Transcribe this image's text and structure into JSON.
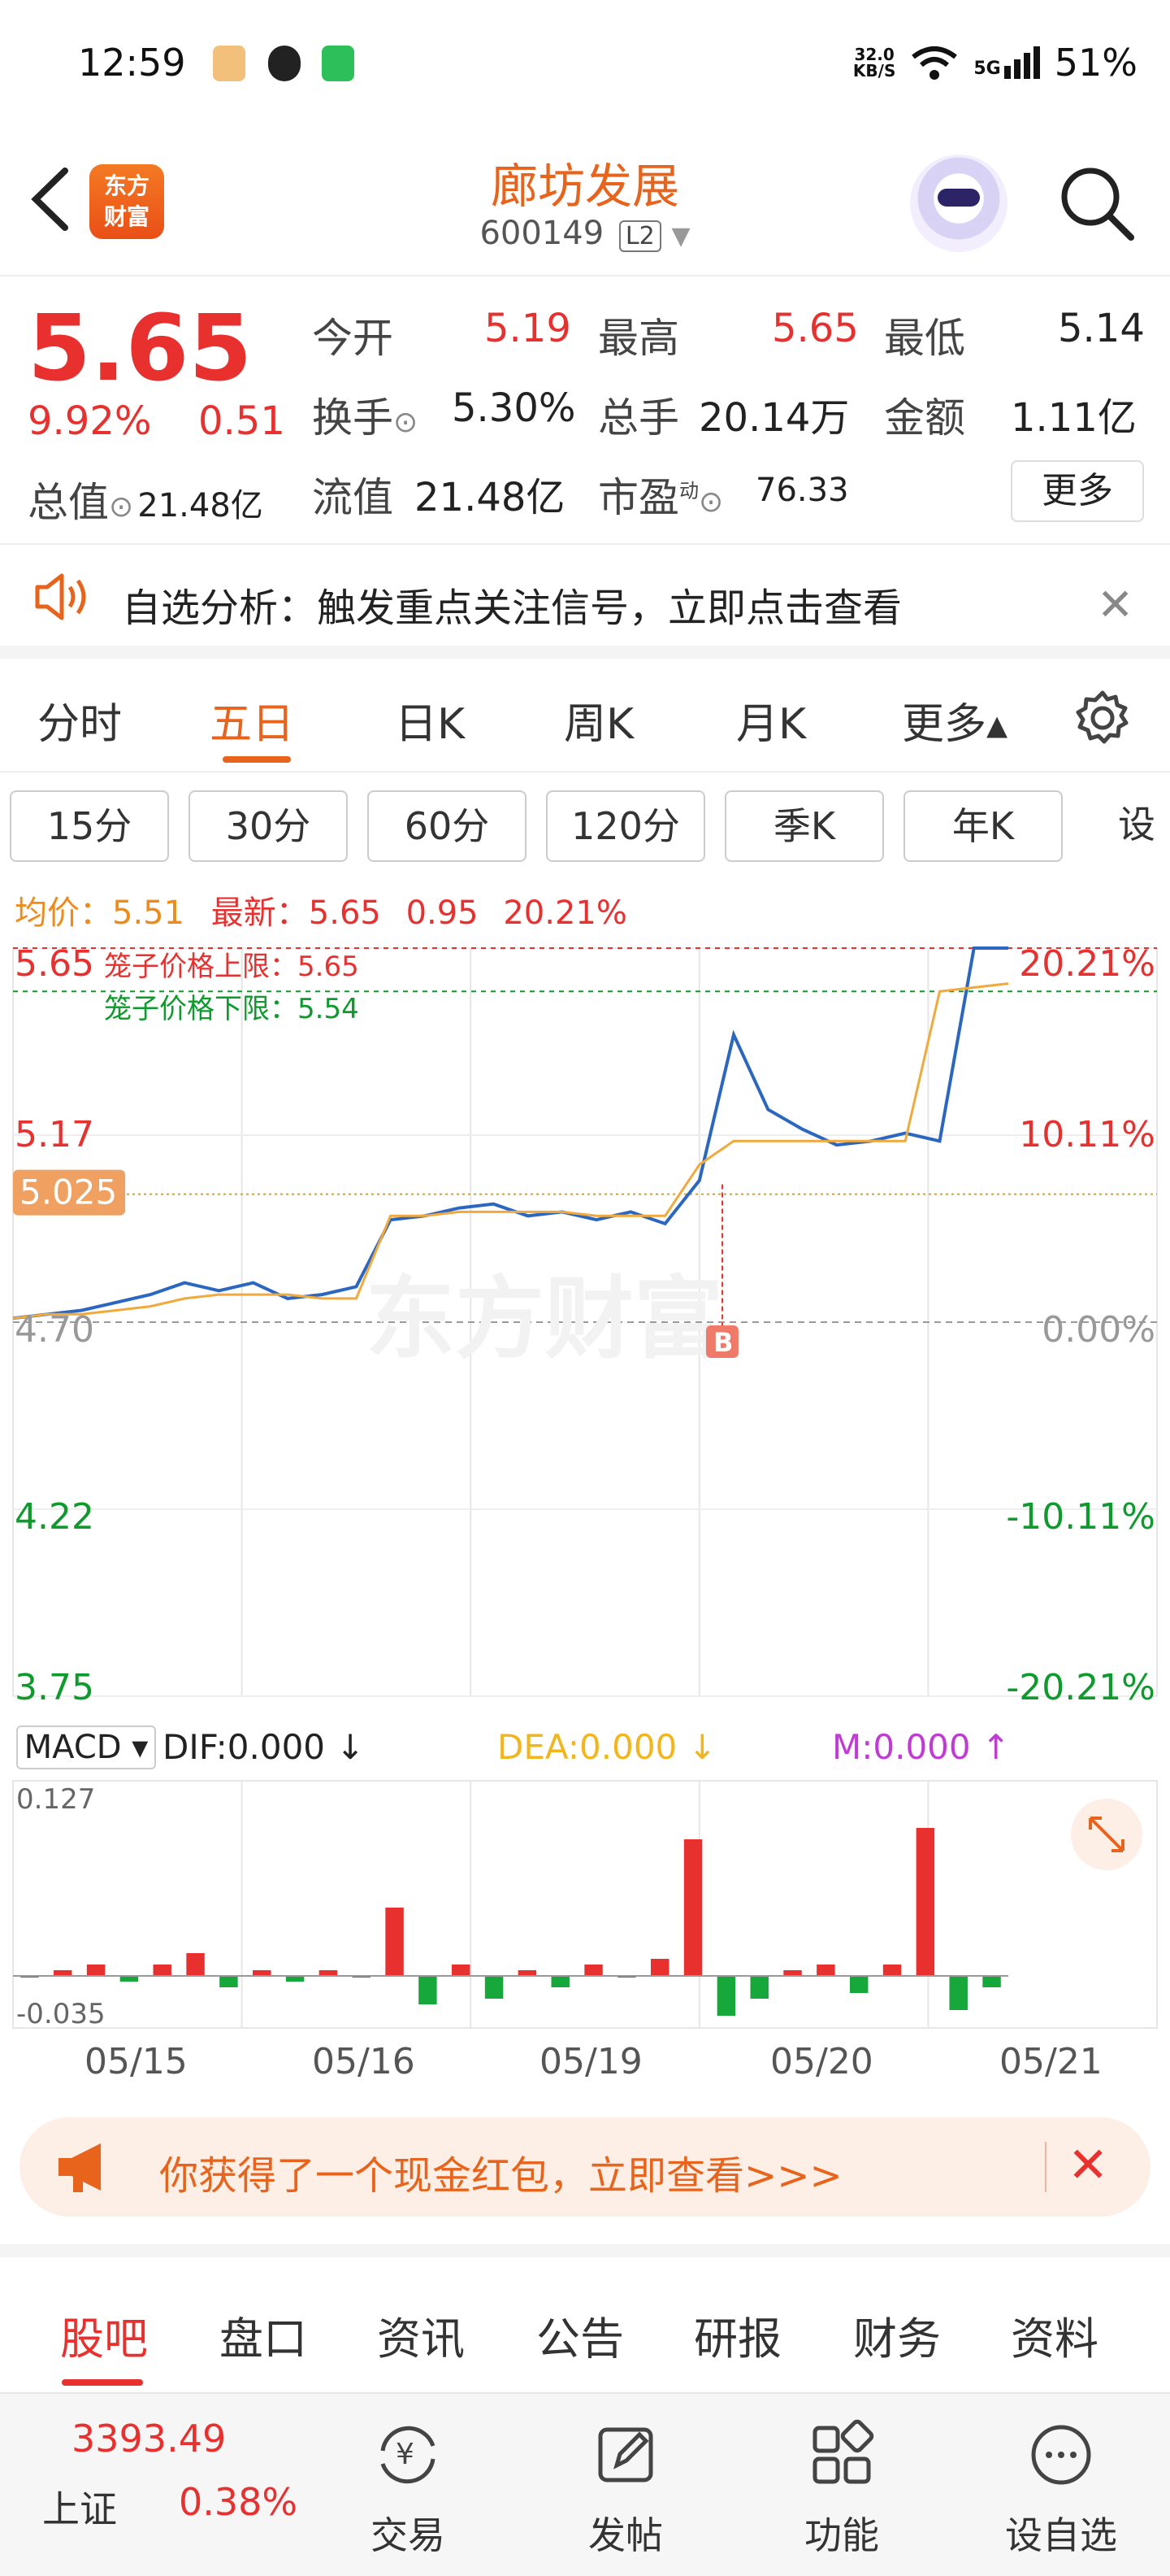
{
  "status": {
    "time": "12:59",
    "net_speed_top": "32.0",
    "net_speed_bottom": "KB/S",
    "signal": "5G",
    "battery": "51%"
  },
  "header": {
    "logo_text_1": "东方",
    "logo_text_2": "财富",
    "stock_name": "廊坊发展",
    "stock_code": "600149",
    "level_badge": "L2"
  },
  "quote": {
    "price": "5.65",
    "change_pct": "9.92%",
    "change_amt": "0.51",
    "market_cap_label": "总值",
    "market_cap": "21.48亿",
    "open_label": "今开",
    "open": "5.19",
    "high_label": "最高",
    "high": "5.65",
    "low_label": "最低",
    "low": "5.14",
    "turnover_label": "换手",
    "turnover": "5.30%",
    "volume_label": "总手",
    "volume": "20.14万",
    "amount_label": "金额",
    "amount": "1.11亿",
    "float_cap_label": "流值",
    "float_cap": "21.48亿",
    "pe_label": "市盈",
    "pe_sup": "动",
    "pe": "76.33",
    "more_label": "更多"
  },
  "notice": {
    "text": "自选分析：触发重点关注信号，立即点击查看",
    "close": "✕"
  },
  "period_tabs": [
    "分时",
    "五日",
    "日K",
    "周K",
    "月K",
    "更多▴"
  ],
  "active_period": "五日",
  "sub_tabs": [
    "15分",
    "30分",
    "60分",
    "120分",
    "季K",
    "年K",
    "设置"
  ],
  "chart_info": {
    "avg_label": "均价：",
    "avg": "5.51",
    "latest_label": "最新：",
    "latest": "5.65",
    "change": "0.95",
    "change_pct": "20.21%"
  },
  "chart_data": {
    "type": "line",
    "title": "",
    "y_left_ticks": [
      "5.65",
      "5.17",
      "4.70",
      "4.22",
      "3.75"
    ],
    "y_right_ticks": [
      "20.21%",
      "10.11%",
      "0.00%",
      "-10.11%",
      "-20.21%"
    ],
    "ylim": [
      3.75,
      5.65
    ],
    "cursor_price": "5.025",
    "cage_upper_label": "笼子价格上限：5.65",
    "cage_lower_label": "笼子价格下限：5.54",
    "buy_marker": "B",
    "watermark": "东方财富",
    "x_dates": [
      "05/15",
      "05/16",
      "05/19",
      "05/20",
      "05/21"
    ],
    "series": [
      {
        "values": [
          4.71,
          4.72,
          4.73,
          4.75,
          4.77,
          4.8,
          4.78,
          4.8,
          4.76,
          4.77,
          4.79,
          4.96,
          4.97,
          4.99,
          5.0,
          4.97,
          4.98,
          4.96,
          4.98,
          4.95,
          5.06,
          5.43,
          5.24,
          5.19,
          5.15,
          5.16,
          5.18,
          5.16,
          5.65,
          5.65
        ]
      },
      {
        "values": [
          4.71,
          4.72,
          4.72,
          4.73,
          4.74,
          4.76,
          4.77,
          4.77,
          4.77,
          4.76,
          4.76,
          4.97,
          4.97,
          4.98,
          4.98,
          4.98,
          4.98,
          4.97,
          4.97,
          4.97,
          5.1,
          5.16,
          5.16,
          5.16,
          5.16,
          5.16,
          5.16,
          5.54,
          5.55,
          5.56
        ]
      }
    ]
  },
  "macd": {
    "selector": "MACD ▾",
    "dif": "DIF:0.000 ↓",
    "dea": "DEA:0.000 ↓",
    "m": "M:0.000 ↑",
    "y_top": "0.127",
    "y_bottom": "-0.035",
    "values": [
      0,
      0.005,
      0.01,
      -0.005,
      0.01,
      0.02,
      -0.01,
      0.005,
      -0.005,
      0.005,
      0,
      0.06,
      -0.025,
      0.01,
      -0.02,
      0.005,
      -0.01,
      0.01,
      0,
      0.015,
      0.12,
      -0.035,
      -0.02,
      0.005,
      0.01,
      -0.015,
      0.01,
      0.13,
      -0.03,
      -0.01
    ]
  },
  "promo": {
    "text": "你获得了一个现金红包，立即查看>>>",
    "close": "✕"
  },
  "content_tabs": [
    "股吧",
    "盘口",
    "资讯",
    "公告",
    "研报",
    "财务",
    "资料"
  ],
  "bottom_nav": {
    "index_value": "3393.49",
    "index_name": "上证",
    "index_change": "0.38%",
    "items": [
      "交易",
      "发帖",
      "功能",
      "设自选"
    ]
  }
}
